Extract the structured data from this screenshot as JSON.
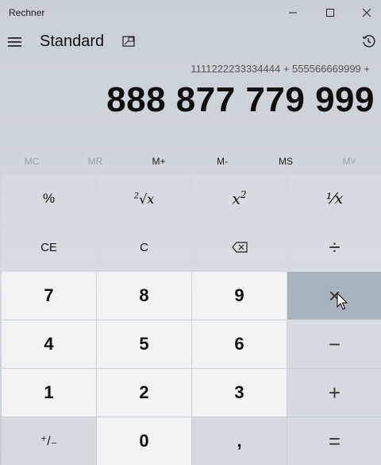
{
  "window": {
    "title": "Rechner"
  },
  "header": {
    "mode": "Standard"
  },
  "display": {
    "expression": "1111222233334444 + 555566669999 +",
    "value": "888 877 779 999"
  },
  "memory": [
    "MC",
    "MR",
    "M+",
    "M-",
    "MS",
    "M˅"
  ],
  "keys": {
    "percent": "%",
    "cuberoot_index": "2",
    "cuberoot_x": "x",
    "square_x": "x",
    "square_exp": "2",
    "reciprocal": "⅟x",
    "ce": "CE",
    "c": "C",
    "divide": "÷",
    "seven": "7",
    "eight": "8",
    "nine": "9",
    "multiply": "×",
    "four": "4",
    "five": "5",
    "six": "6",
    "minus": "−",
    "one": "1",
    "two": "2",
    "three": "3",
    "plus": "+",
    "negate": "⁺/₋",
    "zero": "0",
    "decimal": ",",
    "equals": "="
  }
}
